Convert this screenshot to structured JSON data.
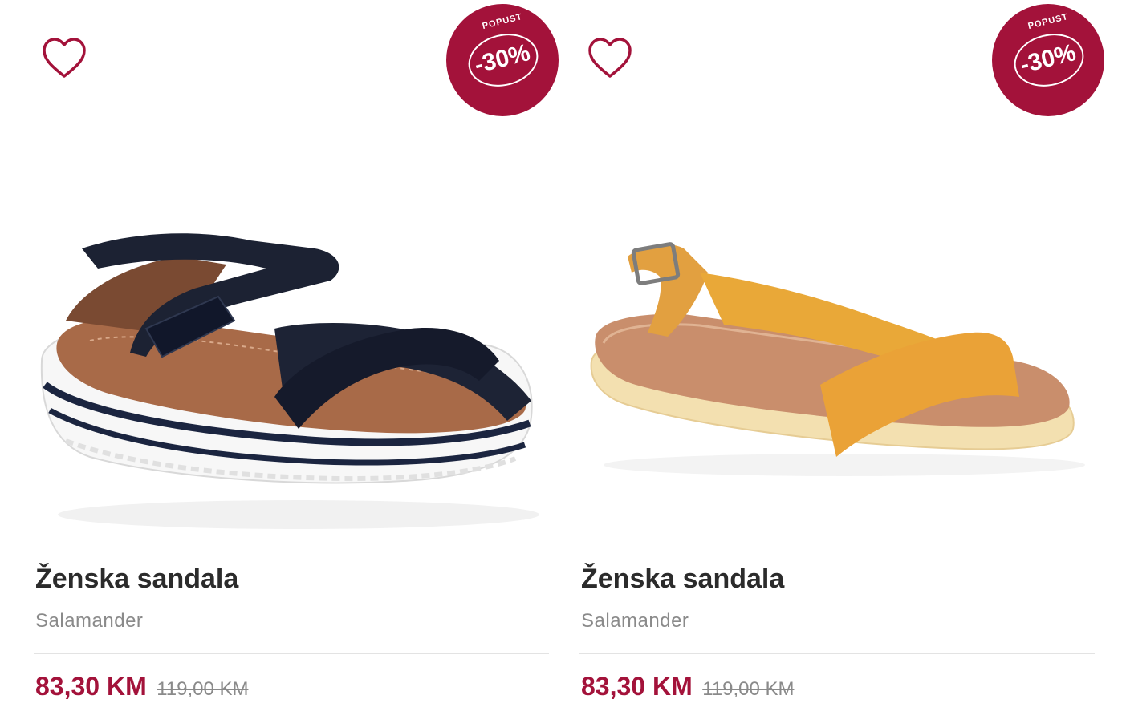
{
  "colors": {
    "accent": "#a3123a",
    "text": "#2b2b2b",
    "muted": "#8a8a8a"
  },
  "products": [
    {
      "image_alt": "Ženska sandala - tamnoplava",
      "badge": {
        "label": "POPUST",
        "percent": "-30%"
      },
      "title": "Ženska sandala",
      "brand": "Salamander",
      "price_new": "83,30 KM",
      "price_old": "119,00 KM",
      "wishlist_icon": "heart-icon"
    },
    {
      "image_alt": "Ženska sandala - žuta",
      "badge": {
        "label": "POPUST",
        "percent": "-30%"
      },
      "title": "Ženska sandala",
      "brand": "Salamander",
      "price_new": "83,30 KM",
      "price_old": "119,00 KM",
      "wishlist_icon": "heart-icon"
    }
  ]
}
